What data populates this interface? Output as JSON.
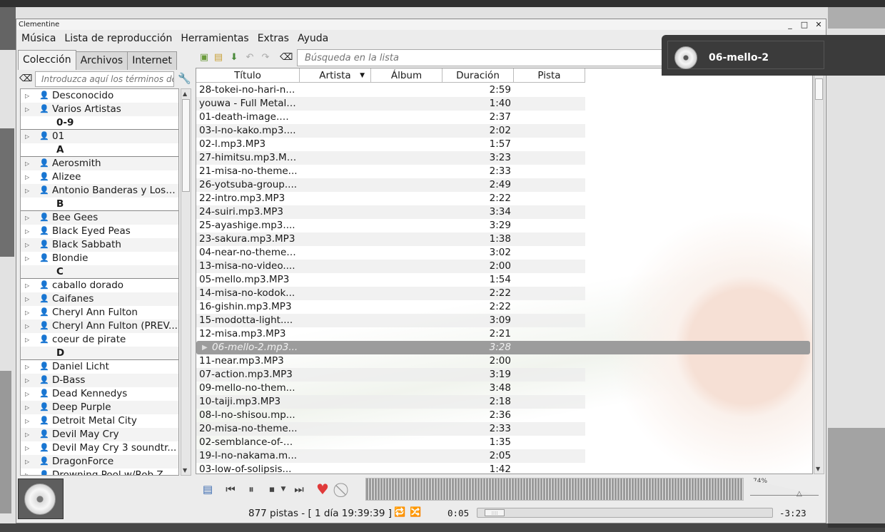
{
  "window": {
    "title": "Clementine",
    "minimize": "_",
    "maximize": "□",
    "close": "✕"
  },
  "menu": [
    "Música",
    "Lista de reproducción",
    "Herramientas",
    "Extras",
    "Ayuda"
  ],
  "library": {
    "tabs": [
      "Colección",
      "Archivos",
      "Internet"
    ],
    "search_placeholder": "Introduzca aquí los términos de búsqueda",
    "items": [
      {
        "type": "artist",
        "label": "Desconocido"
      },
      {
        "type": "artist",
        "label": "Varios Artistas"
      },
      {
        "type": "header",
        "label": "0-9"
      },
      {
        "type": "artist",
        "label": "01"
      },
      {
        "type": "header",
        "label": "A"
      },
      {
        "type": "artist",
        "label": "Aerosmith"
      },
      {
        "type": "artist",
        "label": "Alizee"
      },
      {
        "type": "artist",
        "label": "Antonio Banderas y Los l..."
      },
      {
        "type": "header",
        "label": "B"
      },
      {
        "type": "artist",
        "label": "Bee Gees"
      },
      {
        "type": "artist",
        "label": "Black Eyed Peas"
      },
      {
        "type": "artist",
        "label": "Black Sabbath"
      },
      {
        "type": "artist",
        "label": "Blondie"
      },
      {
        "type": "header",
        "label": "C"
      },
      {
        "type": "artist",
        "label": "caballo dorado"
      },
      {
        "type": "artist",
        "label": "Caifanes"
      },
      {
        "type": "artist",
        "label": "Cheryl Ann Fulton"
      },
      {
        "type": "artist",
        "label": "Cheryl Ann Fulton (PREV..."
      },
      {
        "type": "artist",
        "label": "coeur de pirate"
      },
      {
        "type": "header",
        "label": "D"
      },
      {
        "type": "artist",
        "label": "Daniel Licht"
      },
      {
        "type": "artist",
        "label": "D-Bass"
      },
      {
        "type": "artist",
        "label": "Dead Kennedys"
      },
      {
        "type": "artist",
        "label": "Deep Purple"
      },
      {
        "type": "artist",
        "label": "Detroit Metal City"
      },
      {
        "type": "artist",
        "label": "Devil May Cry"
      },
      {
        "type": "artist",
        "label": "Devil May Cry 3 soundtr..."
      },
      {
        "type": "artist",
        "label": "DragonForce"
      },
      {
        "type": "artist",
        "label": "Drowning Pool w/Rob Zo..."
      }
    ]
  },
  "playlist": {
    "search_placeholder": "Búsqueda en la lista",
    "columns": [
      "Título",
      "Artista",
      "Álbum",
      "Duración",
      "Pista"
    ],
    "tracks": [
      {
        "title": "28-tokei-no-hari-n...",
        "duration": "2:59"
      },
      {
        "title": "youwa - Full Metal ...",
        "duration": "1:40"
      },
      {
        "title": "01-death-image.m...",
        "duration": "2:37"
      },
      {
        "title": "03-l-no-kako.mp3....",
        "duration": "2:02"
      },
      {
        "title": "02-l.mp3.MP3",
        "duration": "1:57"
      },
      {
        "title": "27-himitsu.mp3.MP3",
        "duration": "3:23"
      },
      {
        "title": "21-misa-no-theme...",
        "duration": "2:33"
      },
      {
        "title": "26-yotsuba-group....",
        "duration": "2:49"
      },
      {
        "title": "22-intro.mp3.MP3",
        "duration": "2:22"
      },
      {
        "title": "24-suiri.mp3.MP3",
        "duration": "3:34"
      },
      {
        "title": "25-ayashige.mp3....",
        "duration": "3:29"
      },
      {
        "title": "23-sakura.mp3.MP3",
        "duration": "1:38"
      },
      {
        "title": "04-near-no-theme....",
        "duration": "3:02"
      },
      {
        "title": "13-misa-no-video....",
        "duration": "2:00"
      },
      {
        "title": "05-mello.mp3.MP3",
        "duration": "1:54"
      },
      {
        "title": "14-misa-no-kodok...",
        "duration": "2:22"
      },
      {
        "title": "16-gishin.mp3.MP3",
        "duration": "2:22"
      },
      {
        "title": "15-modotta-light....",
        "duration": "3:09"
      },
      {
        "title": "12-misa.mp3.MP3",
        "duration": "2:21"
      },
      {
        "title": "06-mello-2.mp3...",
        "duration": "3:28",
        "current": true
      },
      {
        "title": "11-near.mp3.MP3",
        "duration": "2:00"
      },
      {
        "title": "07-action.mp3.MP3",
        "duration": "3:19"
      },
      {
        "title": "09-mello-no-them...",
        "duration": "3:48"
      },
      {
        "title": "10-taiji.mp3.MP3",
        "duration": "2:18"
      },
      {
        "title": "08-l-no-shisou.mp...",
        "duration": "2:36"
      },
      {
        "title": "20-misa-no-theme...",
        "duration": "2:33"
      },
      {
        "title": "02-semblance-of-d...",
        "duration": "1:35"
      },
      {
        "title": "19-l-no-nakama.m...",
        "duration": "2:05"
      },
      {
        "title": "03-low-of-solipsis...",
        "duration": "1:42"
      }
    ]
  },
  "player": {
    "volume_label": "74%",
    "volume": 0.74,
    "status": "877 pistas - [ 1 día 19:39:39 ]",
    "elapsed": "0:05",
    "remaining": "-3:23",
    "progress": 0.024
  },
  "osd": {
    "title": "06-mello-2"
  },
  "icons": {
    "clear": "clear-search-icon",
    "heart": "love-icon",
    "ban": "ban-icon"
  },
  "colors": {
    "current_row": "#9c9c9c",
    "love": "#e03a3a",
    "osd_bg": "#3b3b3b"
  }
}
